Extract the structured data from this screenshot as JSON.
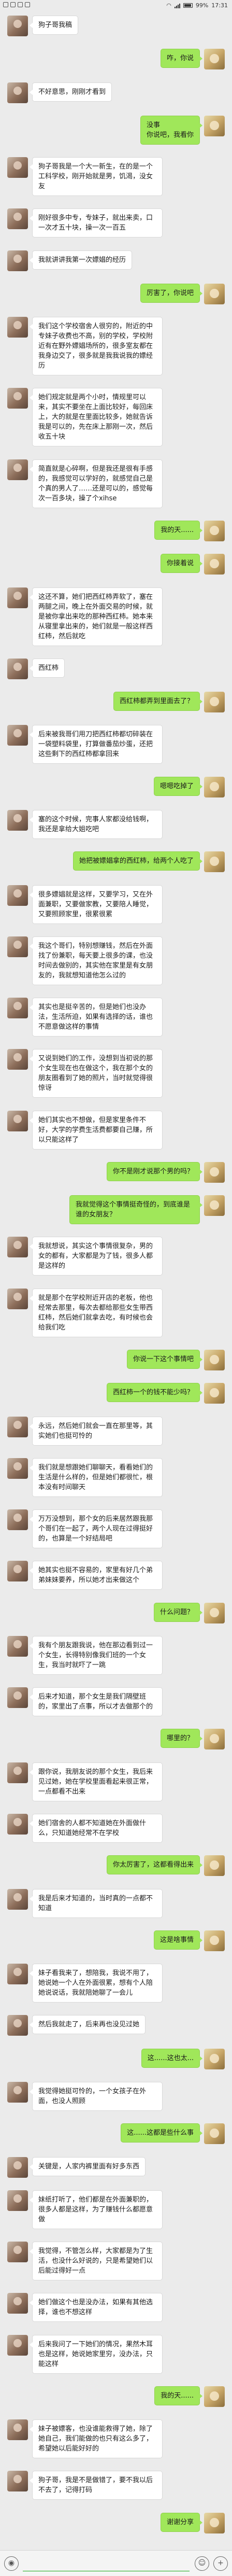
{
  "status_bar": {
    "battery": "99%",
    "time": "17:31"
  },
  "messages": [
    {
      "side": "left",
      "text": "狗子哥我稿"
    },
    {
      "side": "right",
      "text": "咋，你说"
    },
    {
      "side": "left",
      "text": "不好意思，刚刚才看到"
    },
    {
      "side": "right",
      "text": "没事\n你说吧，我看你"
    },
    {
      "side": "left",
      "text": "狗子哥我是一个大一新生，在的是一个工科学校，刚开始就是男，饥渴，没女友"
    },
    {
      "side": "left",
      "text": "刚好很多中专，专妹子，就出来卖，口一次才五十块，操一次一百五"
    },
    {
      "side": "left",
      "text": "我就讲讲我第一次嫖娼的经历"
    },
    {
      "side": "right",
      "text": "厉害了，你说吧"
    },
    {
      "side": "left",
      "text": "我们这个学校宿舍人很穷的，附近的中专妹子收费也不高，别的学校，学校附近有在野外嫖娼场所的，很多室友都在我身边交了，很多就是我我说我的嫖经历"
    },
    {
      "side": "left",
      "text": "她们规定就是两个小时，情规里可以来，其实不要坐在上面比较好，每回床上，大的就是在里面比较多，她就告诉我是可以的，先在床上那刚一次，然后收五十块"
    },
    {
      "side": "left",
      "text": "简直就是心碎啊，但是我还是很有手感的，我感觉可以学好的，就感觉自己是个真的男人了……还是可以的，感觉每次一百多块，操了个xihse"
    },
    {
      "side": "right",
      "text": "我的天......"
    },
    {
      "side": "right",
      "text": "你接着说"
    },
    {
      "side": "left",
      "text": "这还不算，她们把西红柿弄软了，塞在两腿之间，晚上在外面交易的时候，就是被你拿出来吃的那种西红柿。她本来从寝里拿出来的，她们就是一般这样西红柿，然后就吃"
    },
    {
      "side": "left",
      "text": "西红柿"
    },
    {
      "side": "right",
      "text": "西红柿都弄到里面去了？"
    },
    {
      "side": "left",
      "text": "后来被我哥们用刀把西红柿都切碎装在一袋塑料袋里，打算做番茄炒蛋，还把这些剩下的西红柿都拿回来"
    },
    {
      "side": "right",
      "text": "嗯嗯吃掉了"
    },
    {
      "side": "left",
      "text": "塞的这个时候，完事人家都没给钱啊，我还是拿给大姐吃吧"
    },
    {
      "side": "right",
      "text": "她把被嫖娼拿的西红柿，给两个人吃了"
    },
    {
      "side": "left",
      "text": "很多嫖娼就是这样，又要学习，又在外面兼职，又要做家教，又要陪人睡觉，又要照顾家里，很累很累"
    },
    {
      "side": "left",
      "text": "我这个哥们，特别想赚钱，然后在外面找了份兼职，每天要上很多的课，也没时间去做别的，其实他在家里是有女朋友的，我就想知道他怎么过的"
    },
    {
      "side": "left",
      "text": "其实也是挺辛苦的，但是她们也没办法，生活所迫，如果有选择的话，谁也不愿意做这样的事情"
    },
    {
      "side": "left",
      "text": "又说到她们的工作，没想到当初说的那个女生现在也在做这个，我在那个女的朋友圈看到了她的照片，当时就觉得很惊讶"
    },
    {
      "side": "left",
      "text": "她们其实也不想做，但是家里条件不好，大学的学费生活费都要自己赚，所以只能这样了"
    },
    {
      "side": "right",
      "text": "你不是刚才说那个男的吗？"
    },
    {
      "side": "right",
      "text": "我就觉得这个事情挺奇怪的，到底谁是谁的女朋友？"
    },
    {
      "side": "left",
      "text": "我就想说，其实这个事情很复杂，男的女的都有，大家都是为了钱，很多人都是这样的"
    },
    {
      "side": "left",
      "text": "就是那个在学校附近开店的老板，他也经常去那里，每次去都给那些女生带西红柿，然后她们就拿去吃，有时候也会给我们吃"
    },
    {
      "side": "right",
      "text": "你说一下这个事情吧"
    },
    {
      "side": "right",
      "text": "西红柿一个的钱不能少吗？"
    },
    {
      "side": "left",
      "text": "永远，然后她们就会一直在那里等，其实她们也挺可怜的"
    },
    {
      "side": "left",
      "text": "我们就是想跟她们聊聊天，看看她们的生活是什么样的，但是她们都很忙，根本没有时间聊天"
    },
    {
      "side": "left",
      "text": "万万没想到，那个女的后来居然跟我那个哥们在一起了，两个人现在过得挺好的，也算是一个好结局吧"
    },
    {
      "side": "left",
      "text": "她其实也挺不容易的，家里有好几个弟弟妹妹要养，所以她才出来做这个"
    },
    {
      "side": "right",
      "text": "什么问题？"
    },
    {
      "side": "left",
      "text": "我有个朋友跟我说，他在那边看到过一个女生，长得特别像我们班的一个女生，我当时就吓了一跳"
    },
    {
      "side": "left",
      "text": "后来才知道，那个女生是我们隔壁班的，家里出了点事，所以才去做那个的"
    },
    {
      "side": "right",
      "text": "哪里的？"
    },
    {
      "side": "left",
      "text": "跟你说，我朋友说的那个女生，我后来见过她，她在学校里面看起来很正常，一点都看不出来"
    },
    {
      "side": "left",
      "text": "她们宿舍的人都不知道她在外面做什么，只知道她经常不在学校"
    },
    {
      "side": "right",
      "text": "你太厉害了，这都看得出来"
    },
    {
      "side": "left",
      "text": "我是后来才知道的，当时真的一点都不知道"
    },
    {
      "side": "right",
      "text": "这是啥事情"
    },
    {
      "side": "left",
      "text": "妹子看我来了，想陪我，我说不用了，她说她一个人在外面很累，想有个人陪她说说话，我就陪她聊了一会儿"
    },
    {
      "side": "left",
      "text": "然后我就走了，后来再也没见过她"
    },
    {
      "side": "right",
      "text": "这......这也太..."
    },
    {
      "side": "left",
      "text": "我觉得她挺可怜的，一个女孩子在外面，也没人照顾"
    },
    {
      "side": "right",
      "text": "这......这都是些什么事"
    },
    {
      "side": "left",
      "text": "关键是，人家内裤里面有好多东西"
    },
    {
      "side": "left",
      "text": "妹纸打听了，他们都是在外面兼职的，很多人都是这样，为了赚钱什么都愿意做"
    },
    {
      "side": "left",
      "text": "我觉得，不管怎么样，大家都是为了生活，也没什么好说的，只是希望她们以后能过得好一点"
    },
    {
      "side": "left",
      "text": "她们做这个也是没办法，如果有其他选择，谁也不想这样"
    },
    {
      "side": "left",
      "text": "后来我问了一下她们的情况，果然木耳也是这样，她说她家里穷，没办法，只能这样"
    },
    {
      "side": "right",
      "text": "我的天......"
    },
    {
      "side": "left",
      "text": "妹子被嫖客，也没谁能救得了她，除了她自己，我们能做的也只有这么多了，希望她以后能好好的"
    },
    {
      "side": "left",
      "text": "狗子哥，我是不是做错了，要不我以后不去了，记得打码"
    },
    {
      "side": "right",
      "text": "谢谢分享"
    }
  ]
}
